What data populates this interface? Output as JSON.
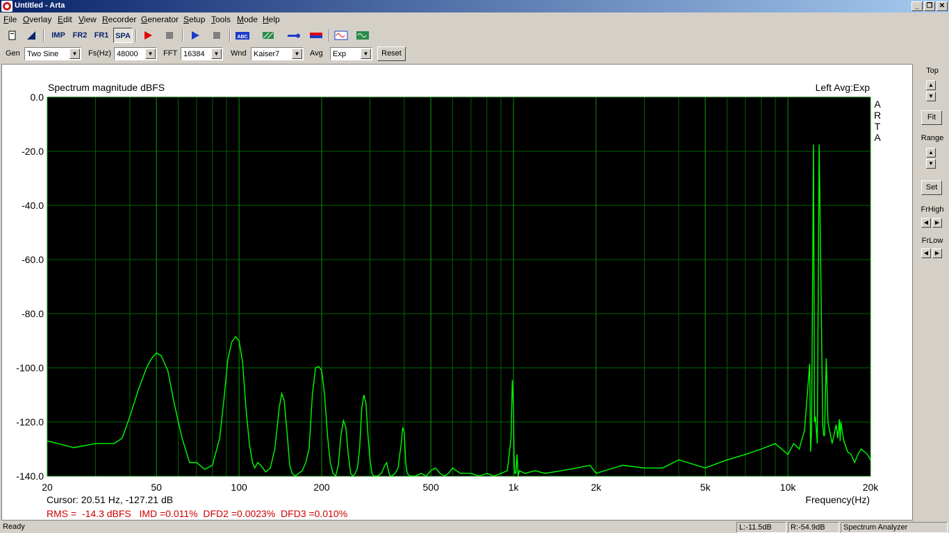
{
  "window": {
    "title": "Untitled - Arta"
  },
  "menu": [
    {
      "first": "F",
      "rest": "ile"
    },
    {
      "first": "O",
      "rest": "verlay"
    },
    {
      "first": "E",
      "rest": "dit"
    },
    {
      "first": "V",
      "rest": "iew"
    },
    {
      "first": "R",
      "rest": "ecorder"
    },
    {
      "first": "G",
      "rest": "enerator"
    },
    {
      "first": "S",
      "rest": "etup"
    },
    {
      "first": "T",
      "rest": "ools"
    },
    {
      "first": "M",
      "rest": "ode"
    },
    {
      "first": "H",
      "rest": "elp"
    }
  ],
  "toolbar": {
    "imp": "IMP",
    "fr2": "FR2",
    "fr1": "FR1",
    "spa": "SPA",
    "abc": "ABC"
  },
  "params": {
    "gen_label": "Gen",
    "gen_value": "Two Sine",
    "fs_label": "Fs(Hz)",
    "fs_value": "48000",
    "fft_label": "FFT",
    "fft_value": "16384",
    "wnd_label": "Wnd",
    "wnd_value": "Kaiser7",
    "avg_label": "Avg",
    "avg_value": "Exp",
    "reset_label": "Reset"
  },
  "side": {
    "top_label": "Top",
    "fit_label": "Fit",
    "range_label": "Range",
    "set_label": "Set",
    "frhigh_label": "FrHigh",
    "frlow_label": "FrLow"
  },
  "plot": {
    "cursor_text": "Cursor: 20.51 Hz, -127.21 dB",
    "measure_text": "RMS =  -14.3 dBFS   IMD =0.011%  DFD2 =0.0023%  DFD3 =0.010%",
    "watermark": [
      "A",
      "R",
      "T",
      "A"
    ]
  },
  "status": {
    "ready": "Ready",
    "left_level": "L:-11.5dB",
    "right_level": "R:-54.9dB",
    "mode": "Spectrum Analyzer"
  },
  "colors": {
    "plot_bg": "#000000",
    "grid": "#006400",
    "trace": "#00ff00",
    "measure": "#cc0000"
  },
  "chart_data": {
    "type": "line",
    "title": "Spectrum magnitude dBFS",
    "legend": "Left   Avg:Exp",
    "xlabel": "Frequency(Hz)",
    "ylabel": "",
    "x_scale": "log",
    "xlim": [
      20,
      20000
    ],
    "ylim": [
      -140,
      0
    ],
    "grid": true,
    "x_ticks": [
      {
        "v": 20,
        "label": "20"
      },
      {
        "v": 50,
        "label": "50"
      },
      {
        "v": 100,
        "label": "100"
      },
      {
        "v": 200,
        "label": "200"
      },
      {
        "v": 500,
        "label": "500"
      },
      {
        "v": 1000,
        "label": "1k"
      },
      {
        "v": 2000,
        "label": "2k"
      },
      {
        "v": 5000,
        "label": "5k"
      },
      {
        "v": 10000,
        "label": "10k"
      },
      {
        "v": 20000,
        "label": "20k"
      }
    ],
    "y_ticks": [
      {
        "v": 0,
        "label": "0.0"
      },
      {
        "v": -20,
        "label": "-20.0"
      },
      {
        "v": -40,
        "label": "-40.0"
      },
      {
        "v": -60,
        "label": "-60.0"
      },
      {
        "v": -80,
        "label": "-80.0"
      },
      {
        "v": -100,
        "label": "-100.0"
      },
      {
        "v": -120,
        "label": "-120.0"
      },
      {
        "v": -140,
        "label": "-140.0"
      }
    ],
    "series": [
      {
        "x": [
          20,
          25,
          30,
          35,
          37.5,
          40,
          43,
          46,
          48,
          50,
          52,
          55,
          58,
          62,
          66,
          70,
          75,
          80,
          85,
          88,
          91,
          94,
          97,
          100,
          103,
          106,
          109,
          112,
          114,
          117,
          120,
          125,
          130,
          135,
          140,
          143,
          146,
          150,
          153,
          156,
          160,
          165,
          170,
          175,
          180,
          185,
          190,
          195,
          200,
          205,
          210,
          215,
          220,
          225,
          230,
          235,
          240,
          245,
          250,
          255,
          260,
          265,
          270,
          275,
          280,
          285,
          290,
          295,
          300,
          305,
          310,
          320,
          330,
          340,
          345,
          350,
          355,
          360,
          370,
          380,
          385,
          390,
          395,
          400,
          405,
          410,
          420,
          440,
          460,
          480,
          500,
          520,
          540,
          560,
          580,
          600,
          620,
          640,
          660,
          700,
          750,
          800,
          850,
          900,
          950,
          980,
          990,
          1000,
          1005,
          1010,
          1020,
          1030,
          1040,
          1050,
          1100,
          1200,
          1300,
          1500,
          1700,
          1900,
          2000,
          2500,
          3000,
          3500,
          4000,
          5000,
          6000,
          7000,
          8000,
          9000,
          10000,
          10500,
          11000,
          11500,
          12000,
          12100,
          12200,
          12400,
          12500,
          12600,
          12800,
          13000,
          13400,
          13500,
          13600,
          13800,
          14000,
          14500,
          15000,
          15200,
          15400,
          15500,
          15600,
          15800,
          16000,
          16500,
          17000,
          17500,
          18000,
          18500,
          19000,
          19500,
          20000
        ],
        "y": [
          -127,
          -129.5,
          -128,
          -128,
          -126,
          -118,
          -108,
          -100,
          -96.5,
          -94.5,
          -95.5,
          -101,
          -113,
          -126,
          -135,
          -135,
          -137.5,
          -136,
          -126,
          -112,
          -97,
          -90.5,
          -88.5,
          -90,
          -98,
          -115,
          -128,
          -135,
          -137,
          -135,
          -136,
          -138.5,
          -137,
          -130,
          -115,
          -109.5,
          -112,
          -125,
          -136,
          -139,
          -140,
          -139,
          -138,
          -135,
          -130,
          -110,
          -100,
          -99.5,
          -101,
          -110,
          -125,
          -135,
          -139,
          -140,
          -136,
          -125,
          -119.5,
          -122,
          -132,
          -139,
          -140,
          -139,
          -137,
          -130,
          -115,
          -110,
          -113,
          -125,
          -134,
          -139,
          -140,
          -140,
          -139,
          -136,
          -135,
          -138,
          -140,
          -140,
          -139,
          -137,
          -132,
          -128,
          -122,
          -124,
          -135,
          -139,
          -140,
          -140,
          -139,
          -140,
          -138,
          -137,
          -139,
          -140,
          -139,
          -137,
          -138,
          -139,
          -139,
          -139,
          -140,
          -139,
          -140,
          -139,
          -138,
          -126,
          -104.5,
          -115,
          -132,
          -139,
          -139,
          -132,
          -140,
          -138,
          -139,
          -138,
          -139,
          -138,
          -137,
          -136,
          -139,
          -136,
          -137,
          -137,
          -134,
          -137,
          -134,
          -132,
          -130,
          -128,
          -132,
          -128,
          -130,
          -123,
          -98.5,
          -131,
          -123,
          -17.5,
          -120,
          -118,
          -128,
          -17.5,
          -121,
          -125,
          -125,
          -96.5,
          -120,
          -128,
          -121,
          -126,
          -119,
          -127,
          -120,
          -124,
          -127,
          -131,
          -132,
          -135,
          -132,
          -130,
          -131,
          -132,
          -134
        ]
      }
    ]
  }
}
